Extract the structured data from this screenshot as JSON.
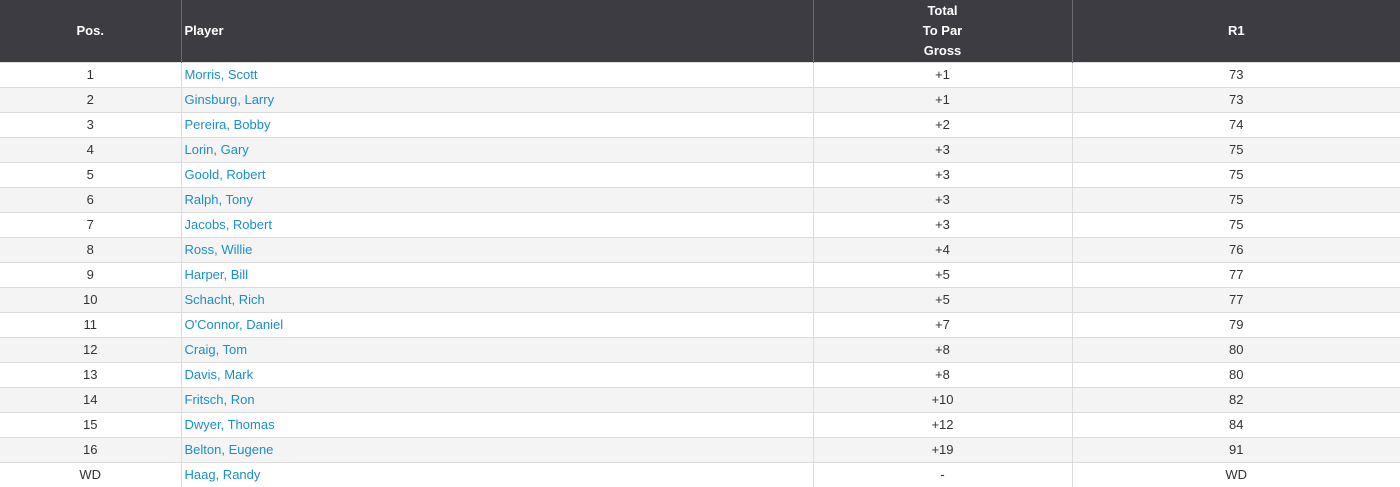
{
  "colors": {
    "header_bg": "#3d3c42",
    "header_text": "#ffffff",
    "link": "#1a8fc9",
    "row_alt": "#f4f4f4"
  },
  "table": {
    "headers": {
      "pos": "Pos.",
      "player": "Player",
      "total_lines": [
        "Total",
        "To Par",
        "Gross"
      ],
      "r1": "R1"
    },
    "rows": [
      {
        "pos": "1",
        "player": "Morris, Scott",
        "to_par": "+1",
        "r1": "73"
      },
      {
        "pos": "2",
        "player": "Ginsburg, Larry",
        "to_par": "+1",
        "r1": "73"
      },
      {
        "pos": "3",
        "player": "Pereira, Bobby",
        "to_par": "+2",
        "r1": "74"
      },
      {
        "pos": "4",
        "player": "Lorin, Gary",
        "to_par": "+3",
        "r1": "75"
      },
      {
        "pos": "5",
        "player": "Goold, Robert",
        "to_par": "+3",
        "r1": "75"
      },
      {
        "pos": "6",
        "player": "Ralph, Tony",
        "to_par": "+3",
        "r1": "75"
      },
      {
        "pos": "7",
        "player": "Jacobs, Robert",
        "to_par": "+3",
        "r1": "75"
      },
      {
        "pos": "8",
        "player": "Ross, Willie",
        "to_par": "+4",
        "r1": "76"
      },
      {
        "pos": "9",
        "player": "Harper, Bill",
        "to_par": "+5",
        "r1": "77"
      },
      {
        "pos": "10",
        "player": "Schacht, Rich",
        "to_par": "+5",
        "r1": "77"
      },
      {
        "pos": "11",
        "player": "O'Connor, Daniel",
        "to_par": "+7",
        "r1": "79"
      },
      {
        "pos": "12",
        "player": "Craig, Tom",
        "to_par": "+8",
        "r1": "80"
      },
      {
        "pos": "13",
        "player": "Davis, Mark",
        "to_par": "+8",
        "r1": "80"
      },
      {
        "pos": "14",
        "player": "Fritsch, Ron",
        "to_par": "+10",
        "r1": "82"
      },
      {
        "pos": "15",
        "player": "Dwyer, Thomas",
        "to_par": "+12",
        "r1": "84"
      },
      {
        "pos": "16",
        "player": "Belton, Eugene",
        "to_par": "+19",
        "r1": "91"
      },
      {
        "pos": "WD",
        "player": "Haag, Randy",
        "to_par": "-",
        "r1": "WD"
      }
    ]
  }
}
